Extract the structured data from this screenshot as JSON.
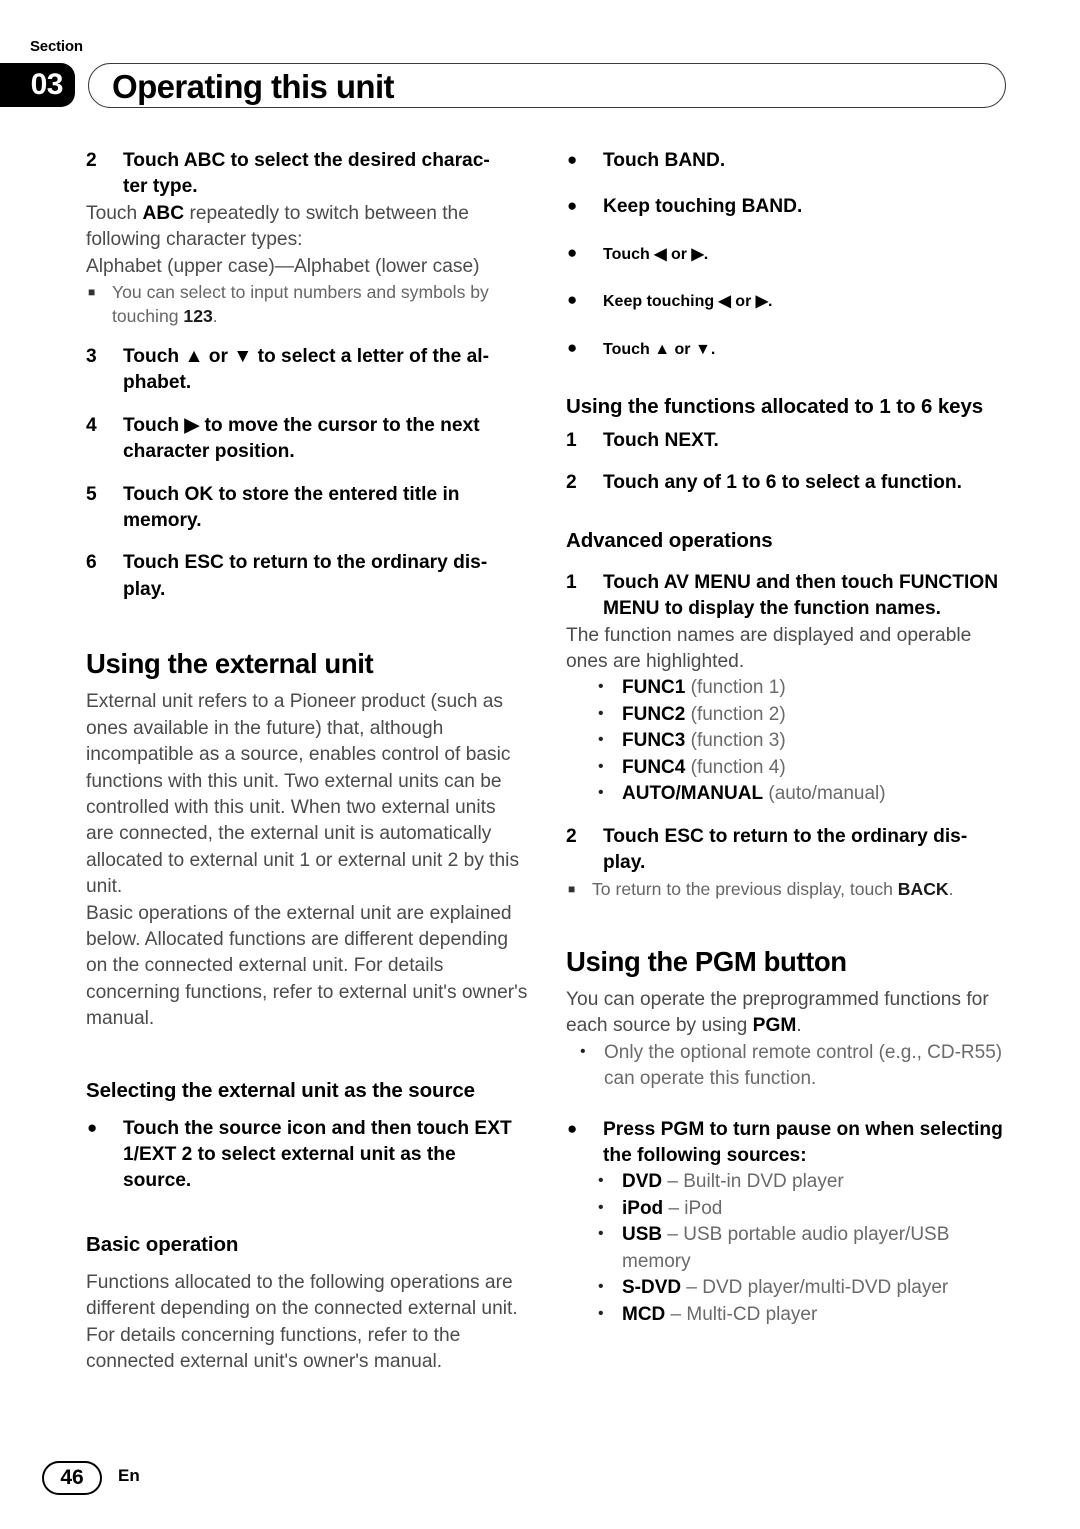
{
  "header": {
    "section_label": "Section",
    "section_number": "03",
    "title": "Operating this unit"
  },
  "left_column": {
    "step2": {
      "num": "2",
      "text_a": "Touch ABC to select the desired charac-",
      "text_b": "ter type."
    },
    "step2_body_line1_a": "Touch ",
    "step2_body_line1_b": "ABC",
    "step2_body_line1_c": " repeatedly to switch between the",
    "step2_body_line2": "following character types:",
    "step2_body_line3": "Alphabet (upper case)—Alphabet (lower case)",
    "note1_a": "You can select to input numbers and symbols by touching ",
    "note1_b": "123",
    "note1_c": ".",
    "step3": {
      "num": "3",
      "text": "Touch ▲ or ▼ to select a letter of the al-phabet."
    },
    "step4": {
      "num": "4",
      "text": "Touch ▶ to move the cursor to the next character position."
    },
    "step5": {
      "num": "5",
      "text": "Touch OK to store the entered title in memory."
    },
    "step6": {
      "num": "6",
      "text": "Touch ESC to return to the ordinary dis-play."
    },
    "h1_external": "Using the external unit",
    "external_para1": "External unit refers to a Pioneer product (such as ones available in the future) that, although incompatible as a source, enables control of basic functions with this unit. Two external units can be controlled with this unit. When two external units are connected, the external unit is automatically allocated to external unit 1 or external unit 2 by this unit.",
    "external_para2": "Basic operations of the external unit are explained below. Allocated functions are different depending on the connected external unit. For details concerning functions, refer to external unit's owner's manual.",
    "h2_selecting": "Selecting the external unit as the source",
    "selecting_bullet": "Touch the source icon and then touch EXT 1/EXT 2 to select external unit as the source.",
    "h2_basic": "Basic operation",
    "basic_para": "Functions allocated to the following operations are different depending on the connected external unit. For details concerning functions, refer to the connected external unit's owner's manual."
  },
  "right_column": {
    "bullets": [
      "Touch BAND.",
      "Keep touching BAND.",
      "Touch ◀ or ▶.",
      "Keep touching ◀ or ▶.",
      "Touch ▲ or ▼."
    ],
    "h2_keys": "Using the functions allocated to 1 to 6 keys",
    "keys_step1": {
      "num": "1",
      "text": "Touch NEXT."
    },
    "keys_step2": {
      "num": "2",
      "text": "Touch any of 1 to 6 to select a function."
    },
    "h2_advanced": "Advanced operations",
    "adv_step1": {
      "num": "1",
      "text": "Touch AV MENU and then touch FUNCTION MENU to display the function names."
    },
    "adv_body": "The function names are displayed and operable ones are highlighted.",
    "func_list": [
      {
        "term": "FUNC1",
        "desc": " (function 1)"
      },
      {
        "term": "FUNC2",
        "desc": " (function 2)"
      },
      {
        "term": "FUNC3",
        "desc": " (function 3)"
      },
      {
        "term": "FUNC4",
        "desc": " (function 4)"
      },
      {
        "term": "AUTO/MANUAL",
        "desc": " (auto/manual)"
      }
    ],
    "adv_step2": {
      "num": "2",
      "text": "Touch ESC to return to the ordinary dis-play."
    },
    "note_back_a": "To return to the previous display, touch ",
    "note_back_b": "BACK",
    "note_back_c": ".",
    "h1_pgm": "Using the PGM button",
    "pgm_para_a": "You can operate the preprogrammed functions for each source by using ",
    "pgm_para_b": "PGM",
    "pgm_para_c": ".",
    "pgm_sub1": "Only the optional remote control (e.g., CD-R55) can operate this function.",
    "pgm_bullet": "Press PGM to turn pause on when selecting the following sources:",
    "source_list": [
      {
        "term": "DVD",
        "desc": " – Built-in DVD player"
      },
      {
        "term": "iPod",
        "desc": " – iPod"
      },
      {
        "term": "USB",
        "desc": " – USB portable audio player/USB memory"
      },
      {
        "term": "S-DVD",
        "desc": " – DVD player/multi-DVD player"
      },
      {
        "term": "MCD",
        "desc": " – Multi-CD player"
      }
    ]
  },
  "footer": {
    "page_number": "46",
    "language": "En"
  }
}
